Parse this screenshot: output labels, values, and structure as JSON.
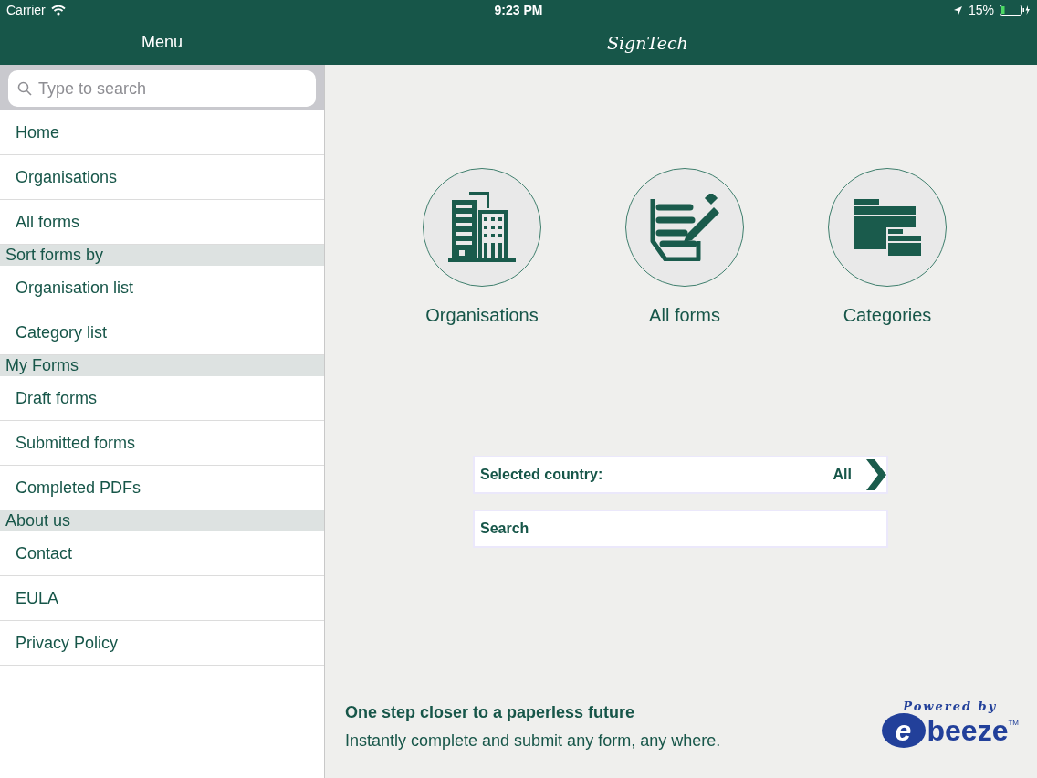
{
  "status_bar": {
    "carrier": "Carrier",
    "time": "9:23 PM",
    "battery": "15%"
  },
  "nav": {
    "menu_title": "Menu",
    "app_title": "SignTech"
  },
  "sidebar": {
    "search": {
      "placeholder": "Type to search"
    },
    "items": [
      {
        "kind": "item",
        "label": "Home"
      },
      {
        "kind": "item",
        "label": "Organisations"
      },
      {
        "kind": "item",
        "label": "All forms"
      },
      {
        "kind": "header",
        "label": "Sort forms by"
      },
      {
        "kind": "item",
        "label": "Organisation list"
      },
      {
        "kind": "item",
        "label": "Category list"
      },
      {
        "kind": "header",
        "label": "My Forms"
      },
      {
        "kind": "item",
        "label": "Draft forms"
      },
      {
        "kind": "item",
        "label": "Submitted forms"
      },
      {
        "kind": "item",
        "label": "Completed PDFs"
      },
      {
        "kind": "header",
        "label": "About us"
      },
      {
        "kind": "item",
        "label": "Contact"
      },
      {
        "kind": "item",
        "label": "EULA"
      },
      {
        "kind": "item",
        "label": "Privacy Policy"
      }
    ]
  },
  "shortcuts": [
    {
      "kind": "building",
      "label": "Organisations"
    },
    {
      "kind": "form",
      "label": "All forms"
    },
    {
      "kind": "folders",
      "label": "Categories"
    }
  ],
  "country": {
    "label": "Selected country:",
    "value": "All"
  },
  "search_row": {
    "label": "Search"
  },
  "footer": {
    "headline": "One step closer to a paperless future",
    "tagline": "Instantly complete and submit any form, any where.",
    "powered_by": "Powered by",
    "logo_mark": "e",
    "logo_text": "beeze",
    "trademark": "TM"
  }
}
